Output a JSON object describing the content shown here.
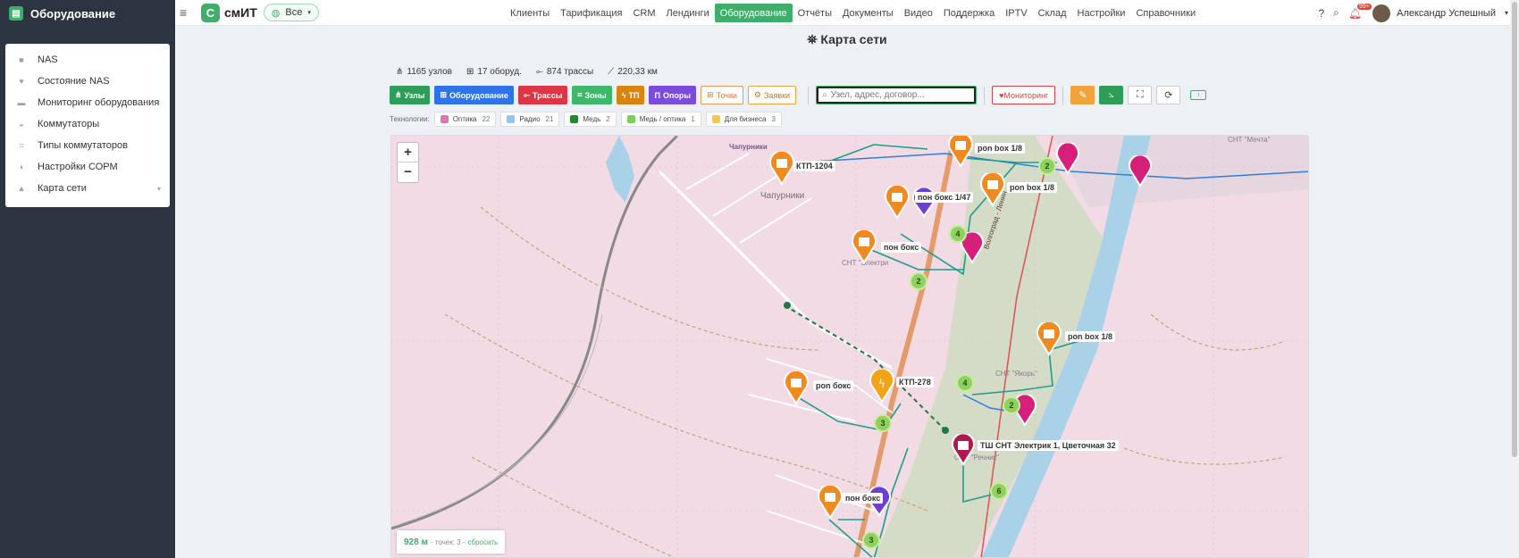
{
  "sidebar": {
    "title": "Оборудование",
    "items": [
      {
        "label": "NAS",
        "icon": "server-icon"
      },
      {
        "label": "Состояние NAS",
        "icon": "heart-icon"
      },
      {
        "label": "Мониторинг оборудования",
        "icon": "monitor-icon"
      },
      {
        "label": "Коммутаторы",
        "icon": "switch-icon"
      },
      {
        "label": "Типы коммутаторов",
        "icon": "sitemap-icon"
      },
      {
        "label": "Настройки СОРМ",
        "icon": "shield-icon"
      },
      {
        "label": "Карта сети",
        "icon": "map-icon"
      }
    ]
  },
  "topbar": {
    "logo": "смИТ",
    "scope": "Все",
    "nav": [
      "Клиенты",
      "Тарификация",
      "CRM",
      "Лендинги",
      "Оборудование",
      "Отчёты",
      "Документы",
      "Видео",
      "Поддержка",
      "IPTV",
      "Склад",
      "Настройки",
      "Справочники"
    ],
    "active_nav": "Оборудование",
    "notifications": "99+",
    "user": "Александр Успешный"
  },
  "page": {
    "title": "Карта сети"
  },
  "stats": {
    "nodes": "1165 узлов",
    "equipment": "17 оборуд.",
    "routes": "874 трассы",
    "length": "220,33 км"
  },
  "layers": [
    {
      "label": "Узлы",
      "color": "#2f9d5a"
    },
    {
      "label": "Оборудование",
      "color": "#2f73e8"
    },
    {
      "label": "Трассы",
      "color": "#dc3545"
    },
    {
      "label": "Зоны",
      "color": "#3fb86b"
    },
    {
      "label": "ТП",
      "color": "#d9840d"
    },
    {
      "label": "Опоры",
      "color": "#7b4bdc"
    },
    {
      "label": "Точки",
      "color": "#e07a2f"
    },
    {
      "label": "Заявки",
      "color": "#c47f10"
    }
  ],
  "search": {
    "placeholder": "Узел, адрес, договор..."
  },
  "monitoring": "Мониторинг",
  "technologies": {
    "label": "Технологии:",
    "items": [
      {
        "label": "Оптика",
        "count": "22",
        "color": "#e66fb5"
      },
      {
        "label": "Радио",
        "count": "21",
        "color": "#8fc7ef"
      },
      {
        "label": "Медь",
        "count": "2",
        "color": "#1f8a2b"
      },
      {
        "label": "Медь / оптика",
        "count": "1",
        "color": "#7ccf57"
      },
      {
        "label": "Для бизнеса",
        "count": "3",
        "color": "#f4c94a"
      }
    ]
  },
  "map": {
    "zoom_in": "+",
    "zoom_out": "−",
    "scale": {
      "distance": "928 м",
      "points": "· точек: 3 ·",
      "reset": "сбросить"
    },
    "place_labels": [
      "Чапурники",
      "Чапурники",
      "СНТ \"Мечта\"",
      "СНТ \"Электри",
      "СНТ \"Якорь\"",
      "СНТ \"Речник\"",
      "Волгоград - Ленин"
    ],
    "markers": [
      {
        "label": "pon box 1/8"
      },
      {
        "label": "КТП-1204"
      },
      {
        "label": "pon box 1/8"
      },
      {
        "label": "пон бокс 1/47"
      },
      {
        "label": "пон бокс"
      },
      {
        "label": "pon box 1/8"
      },
      {
        "label": "pon бокс"
      },
      {
        "label": "КТП-278"
      },
      {
        "label": "ТШ СНТ Электрик 1, Цветочная 32"
      },
      {
        "label": "пон бокс"
      }
    ],
    "clusters": [
      "2",
      "4",
      "2",
      "4",
      "2",
      "3",
      "6",
      "3"
    ]
  }
}
